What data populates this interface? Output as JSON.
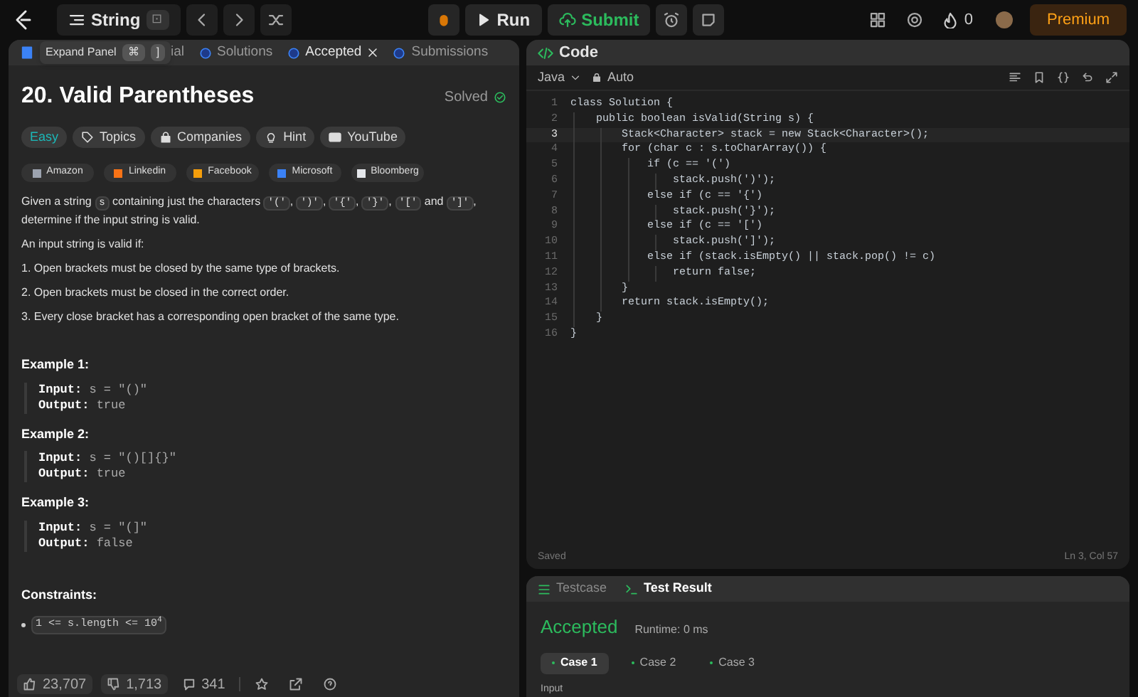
{
  "topbar": {
    "problem_list": "String",
    "badge": "⊡",
    "run": "Run",
    "submit": "Submit",
    "streak": "0",
    "premium": "Premium"
  },
  "left_panel": {
    "tooltip": {
      "label": "Expand Panel",
      "keys": [
        "⌘",
        "]"
      ]
    },
    "tabs": [
      {
        "label": "ial",
        "selected": false,
        "closable": false
      },
      {
        "label": "Solutions",
        "selected": false,
        "closable": false
      },
      {
        "label": "Accepted",
        "selected": true,
        "closable": true
      },
      {
        "label": "Submissions",
        "selected": false,
        "closable": false
      }
    ],
    "title": "20. Valid Parentheses",
    "status": "Solved",
    "tags": [
      {
        "label": "Easy",
        "kind": "difficulty"
      },
      {
        "label": "Topics",
        "kind": "tag"
      },
      {
        "label": "Companies",
        "kind": "lock"
      },
      {
        "label": "Hint",
        "kind": "bulb"
      },
      {
        "label": "YouTube",
        "kind": "video"
      }
    ],
    "companies": [
      {
        "label": "Amazon",
        "color": "#9ca3af"
      },
      {
        "label": "Linkedin",
        "color": "#f97316"
      },
      {
        "label": "Facebook",
        "color": "#f59e0b"
      },
      {
        "label": "Microsoft",
        "color": "#3b82f6"
      },
      {
        "label": "Bloomberg",
        "color": "#e5e7eb"
      }
    ],
    "description": [
      [
        {
          "kind": "text",
          "text": "Given a string "
        },
        {
          "kind": "code",
          "text": "s"
        },
        {
          "kind": "text",
          "text": " containing just the characters "
        },
        {
          "kind": "code",
          "text": "'('"
        },
        {
          "kind": "text",
          "text": ", "
        },
        {
          "kind": "code",
          "text": "')'"
        },
        {
          "kind": "text",
          "text": ", "
        },
        {
          "kind": "code",
          "text": "'{'"
        },
        {
          "kind": "text",
          "text": ", "
        },
        {
          "kind": "code",
          "text": "'}'"
        },
        {
          "kind": "text",
          "text": ", "
        },
        {
          "kind": "code",
          "text": "'['"
        },
        {
          "kind": "text",
          "text": " and "
        },
        {
          "kind": "code",
          "text": "']'"
        },
        {
          "kind": "text",
          "text": ", determine if the input string is valid."
        }
      ],
      [
        {
          "kind": "text",
          "text": "An input string is valid if:"
        }
      ],
      [
        {
          "kind": "text",
          "text": "1. Open brackets must be closed by the same type of brackets."
        }
      ],
      [
        {
          "kind": "text",
          "text": "2. Open brackets must be closed in the correct order."
        }
      ],
      [
        {
          "kind": "text",
          "text": "3. Every close bracket has a corresponding open bracket of the same type."
        }
      ]
    ],
    "examples": [
      {
        "title": "Example 1:",
        "input_label": "Input:",
        "input": "s = \"()\"",
        "output_label": "Output:",
        "output": "true"
      },
      {
        "title": "Example 2:",
        "input_label": "Input:",
        "input": "s = \"()[]{}\"",
        "output_label": "Output:",
        "output": "true"
      },
      {
        "title": "Example 3:",
        "input_label": "Input:",
        "input": "s = \"(]\"",
        "output_label": "Output:",
        "output": "false"
      }
    ],
    "constraints_title": "Constraints:",
    "constraints": [
      "1 <= s.length <= 10$^{4}$"
    ],
    "footer": {
      "likes": "23,707",
      "dislikes": "1,713",
      "comments": "341"
    }
  },
  "code_panel": {
    "title": "Code",
    "language": "Java",
    "mode": "Auto",
    "lines": [
      {
        "number": "1",
        "text": "class Solution {",
        "current": false
      },
      {
        "number": "2",
        "text": "    public boolean isValid(String s) {",
        "current": false
      },
      {
        "number": "3",
        "text": "        Stack<Character> stack = new Stack<Character>();",
        "current": true
      },
      {
        "number": "4",
        "text": "        for (char c : s.toCharArray()) {",
        "current": false
      },
      {
        "number": "5",
        "text": "            if (c == '(')",
        "current": false
      },
      {
        "number": "6",
        "text": "                stack.push(')');",
        "current": false
      },
      {
        "number": "7",
        "text": "            else if (c == '{')",
        "current": false
      },
      {
        "number": "8",
        "text": "                stack.push('}');",
        "current": false
      },
      {
        "number": "9",
        "text": "            else if (c == '[')",
        "current": false
      },
      {
        "number": "10",
        "text": "                stack.push(']');",
        "current": false
      },
      {
        "number": "11",
        "text": "            else if (stack.isEmpty() || stack.pop() != c)",
        "current": false
      },
      {
        "number": "12",
        "text": "                return false;",
        "current": false
      },
      {
        "number": "13",
        "text": "        }",
        "current": false
      },
      {
        "number": "14",
        "text": "        return stack.isEmpty();",
        "current": false
      },
      {
        "number": "15",
        "text": "    }",
        "current": false
      },
      {
        "number": "16",
        "text": "}",
        "current": false
      }
    ],
    "saved": "Saved",
    "cursor": "Ln 3, Col 57"
  },
  "result_panel": {
    "tabs": [
      {
        "label": "Testcase",
        "selected": false
      },
      {
        "label": "Test Result",
        "selected": true
      }
    ],
    "verdict": "Accepted",
    "runtime": "Runtime: 0 ms",
    "cases": [
      {
        "label": "Case 1",
        "selected": true
      },
      {
        "label": "Case 2",
        "selected": false
      },
      {
        "label": "Case 3",
        "selected": false
      }
    ],
    "input_label": "Input"
  }
}
